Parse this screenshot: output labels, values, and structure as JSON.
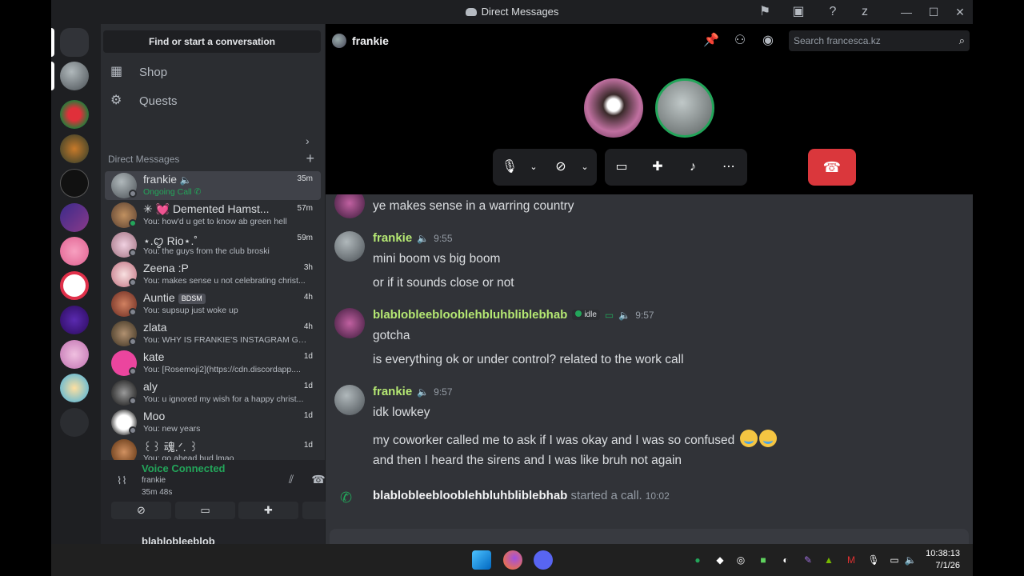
{
  "window": {
    "title": "Direct Messages"
  },
  "sidebar": {
    "search_placeholder": "Find or start a conversation",
    "nav": [
      {
        "label": "Shop",
        "icon": "shop-icon"
      },
      {
        "label": "Quests",
        "icon": "quests-icon"
      }
    ],
    "dm_header": "Direct Messages",
    "dms": [
      {
        "name": "frankie",
        "sub": "Ongoing Call",
        "time": "35m",
        "active": true,
        "color": "#7a8a8f"
      },
      {
        "name": "✳ 💓 Demented Hamst...",
        "sub": "You: how'd u get to know ab green hell",
        "time": "57m",
        "color": "#8a6a50"
      },
      {
        "name": "⋆.ꨄ Rio⋆.˚",
        "sub": "You: the guys from the club broski",
        "time": "59m",
        "color": "#c9a0b0"
      },
      {
        "name": "Zeena :P",
        "sub": "You: makes sense u not celebrating christ...",
        "time": "3h",
        "color": "#d4a0a8"
      },
      {
        "name": "Auntie",
        "tag": "BDSM",
        "sub": "You: supsup just woke up",
        "time": "4h",
        "color": "#a04a40"
      },
      {
        "name": "zlata",
        "sub": "You: WHY IS FRANKIE'S INSTAGRAM GO...",
        "time": "4h",
        "color": "#6a6050"
      },
      {
        "name": "kate",
        "sub": "You: [Rosemoji2](https://cdn.discordapp....",
        "time": "1d",
        "color": "#eb459e"
      },
      {
        "name": "aly",
        "sub": "You: u ignored my wish for a happy christ...",
        "time": "1d",
        "color": "#3a3a3a"
      },
      {
        "name": "Moo",
        "sub": "You: new years",
        "time": "1d",
        "color": "#dddddd"
      },
      {
        "name": "꒰꒱ 魂.ᐟ. ꒱",
        "sub": "You: go ahead bud lmao",
        "time": "1d",
        "color": "#a06a40"
      }
    ]
  },
  "voice": {
    "status": "Voice Connected",
    "channel": "frankie",
    "duration": "35m 48s"
  },
  "userbar": {
    "name": "blablobleeblob"
  },
  "channel": {
    "name": "frankie",
    "search_placeholder": "Search francesca.kz"
  },
  "messages": {
    "top_line": "ye makes sense in a warring country",
    "groups": [
      {
        "author": "frankie",
        "time": "9:55",
        "lines": [
          "mini boom vs big boom",
          "or if it sounds close or not"
        ]
      },
      {
        "author": "blablobleeblooblehbluhbliblebhab",
        "status": "idle",
        "time": "9:57",
        "lines": [
          "gotcha",
          "is everything ok or under control? related to the work call"
        ]
      },
      {
        "author": "frankie",
        "time": "9:57",
        "lines": [
          "idk lowkey",
          "my coworker called me to ask if I was okay and I was so confused",
          "and then I heard the sirens and I was like bruh not again"
        ]
      }
    ],
    "system": {
      "who": "blablobleeblooblehbluhbliblebhab",
      "text": "started a call.",
      "time": "10:02"
    }
  },
  "taskbar": {
    "time": "10:38:13",
    "date": "7/1/26"
  }
}
